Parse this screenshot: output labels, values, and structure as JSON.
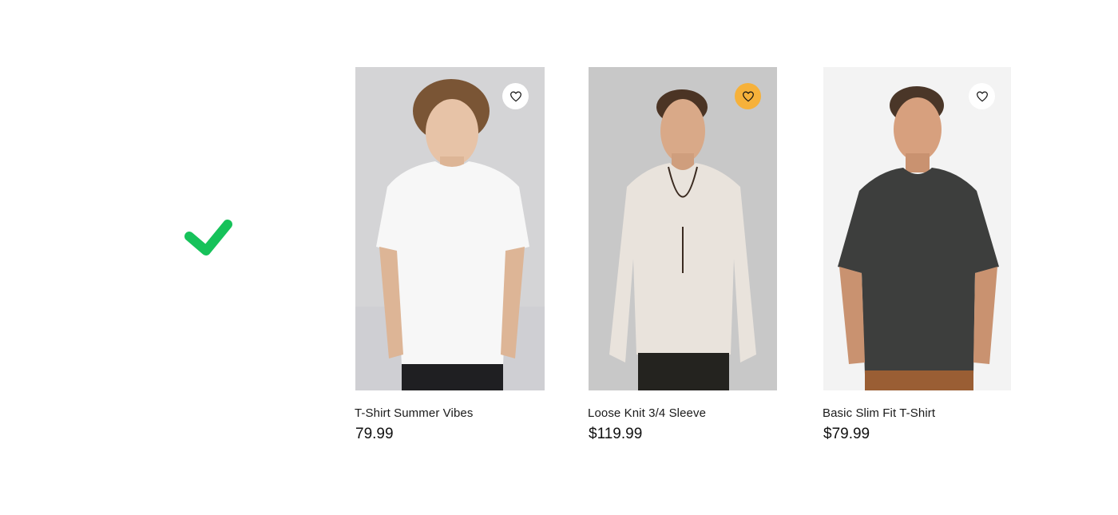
{
  "status_icon": {
    "name": "checkmark-icon",
    "color": "#16c25a"
  },
  "accent_color": "#f6b13a",
  "products": [
    {
      "title": "T-Shirt Summer Vibes",
      "price": "79.99",
      "favorite_active": false,
      "favorite_icon": "heart-icon"
    },
    {
      "title": "Loose Knit 3/4 Sleeve",
      "price": "$119.99",
      "favorite_active": true,
      "favorite_icon": "heart-icon"
    },
    {
      "title": "Basic Slim Fit T-Shirt",
      "price": "$79.99",
      "favorite_active": false,
      "favorite_icon": "heart-icon"
    }
  ]
}
